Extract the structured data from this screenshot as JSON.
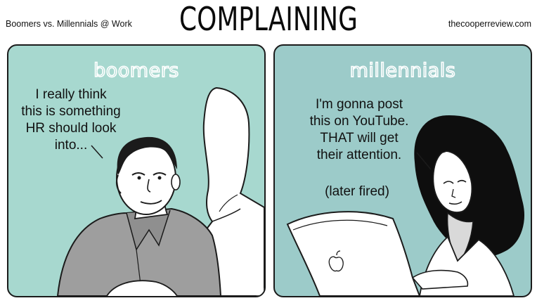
{
  "header": {
    "left": "Boomers vs. Millennials @ Work",
    "title": "COMPLAINING",
    "right": "thecooperreview.com"
  },
  "panels": {
    "left": {
      "label": "boomers",
      "speech": "I really think\nthis is something\nHR should look\ninto..."
    },
    "right": {
      "label": "millennials",
      "speech": "I'm gonna post\nthis on YouTube.\nTHAT will get\ntheir attention.",
      "aside": "(later fired)"
    }
  },
  "colors": {
    "left_panel": "#a7d8cf",
    "right_panel": "#9ccbc9",
    "outline": "#1b1b1b"
  }
}
